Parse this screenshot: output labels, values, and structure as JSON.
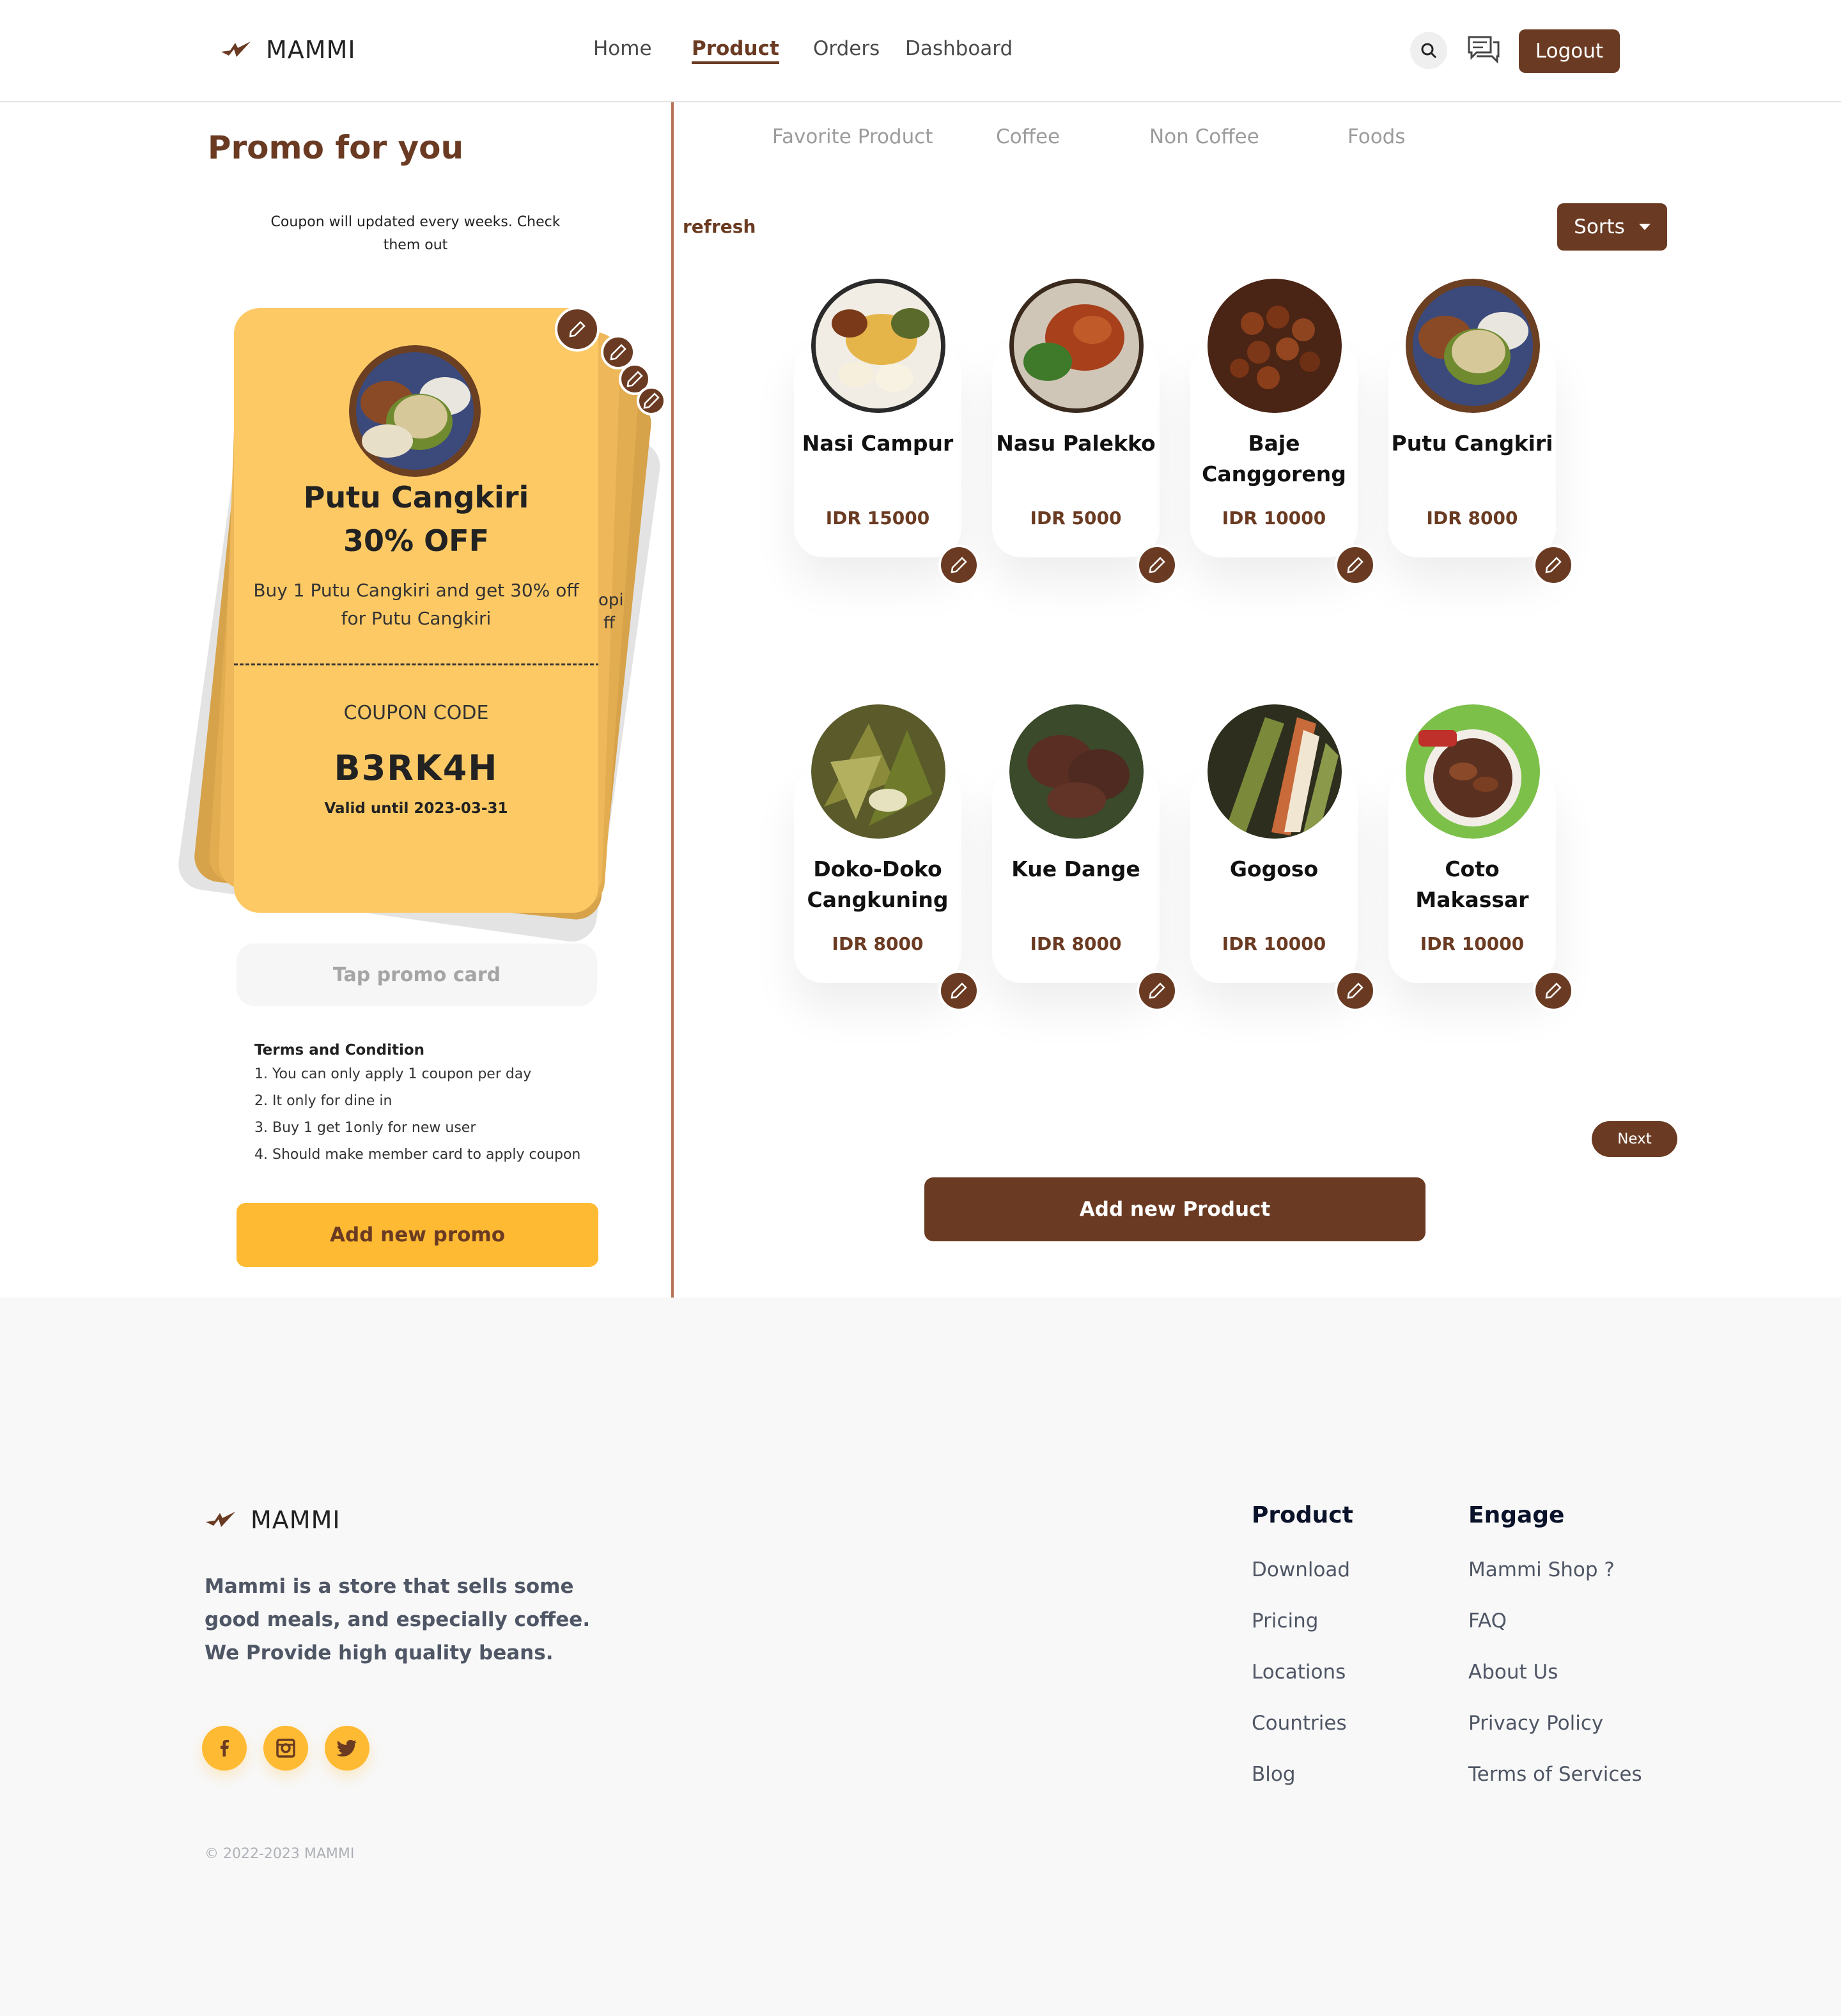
{
  "app": {
    "brand": "MAMMI"
  },
  "nav": {
    "home": "Home",
    "product": "Product",
    "orders": "Orders",
    "dashboard": "Dashboard",
    "logout": "Logout"
  },
  "promo": {
    "title": "Promo for you",
    "subtitle": "Coupon will updated every weeks. Check them out",
    "card": {
      "name": "Putu Cangkiri",
      "discount": "30% OFF",
      "description": "Buy 1 Putu Cangkiri and get 30% off for Putu Cangkiri",
      "coupon_label": "COUPON CODE",
      "coupon_code": "B3RK4H",
      "valid": "Valid until 2023-03-31",
      "behind_fragment_1": "opi",
      "behind_fragment_2": "ff"
    },
    "tap_label": "Tap promo card",
    "terms_title": "Terms and Condition",
    "terms": [
      "1. You can only apply 1 coupon per day",
      "2. It only for dine in",
      "3. Buy 1 get 1only for new user",
      "4. Should make member card to apply coupon"
    ],
    "add_button": "Add new promo"
  },
  "products": {
    "tabs": [
      "Favorite Product",
      "Coffee",
      "Non Coffee",
      "Foods"
    ],
    "refresh": "refresh",
    "sorts": "Sorts",
    "items": [
      {
        "name": "Nasi Campur",
        "price": "IDR 15000"
      },
      {
        "name": "Nasu Palekko",
        "price": "IDR 5000"
      },
      {
        "name": "Baje Canggoreng",
        "price": "IDR 10000"
      },
      {
        "name": "Putu Cangkiri",
        "price": "IDR 8000"
      },
      {
        "name": "Doko-Doko Cangkuning",
        "price": "IDR 8000"
      },
      {
        "name": "Kue Dange",
        "price": "IDR 8000"
      },
      {
        "name": "Gogoso",
        "price": "IDR 10000"
      },
      {
        "name": "Coto Makassar",
        "price": "IDR 10000"
      }
    ],
    "next": "Next",
    "add_button": "Add new Product"
  },
  "footer": {
    "brand": "MAMMI",
    "description": "Mammi is a store that sells some good meals, and especially coffee. We Provide high quality beans.",
    "copyright": "© 2022-2023 MAMMI",
    "product_title": "Product",
    "product_links": [
      "Download",
      "Pricing",
      "Locations",
      "Countries",
      "Blog"
    ],
    "engage_title": "Engage",
    "engage_links": [
      "Mammi Shop ?",
      "FAQ",
      "About Us",
      "Privacy Policy",
      "Terms of Services"
    ]
  },
  "colors": {
    "brown": "#6a3b22",
    "yellow": "#ffba33",
    "card_yellow": "#fdc965",
    "footer_bg": "#f8f8f8"
  },
  "icons": [
    "logo-icon",
    "search-icon",
    "chat-icon",
    "edit-icon",
    "facebook-icon",
    "instagram-icon",
    "twitter-icon",
    "caret-down-icon"
  ]
}
